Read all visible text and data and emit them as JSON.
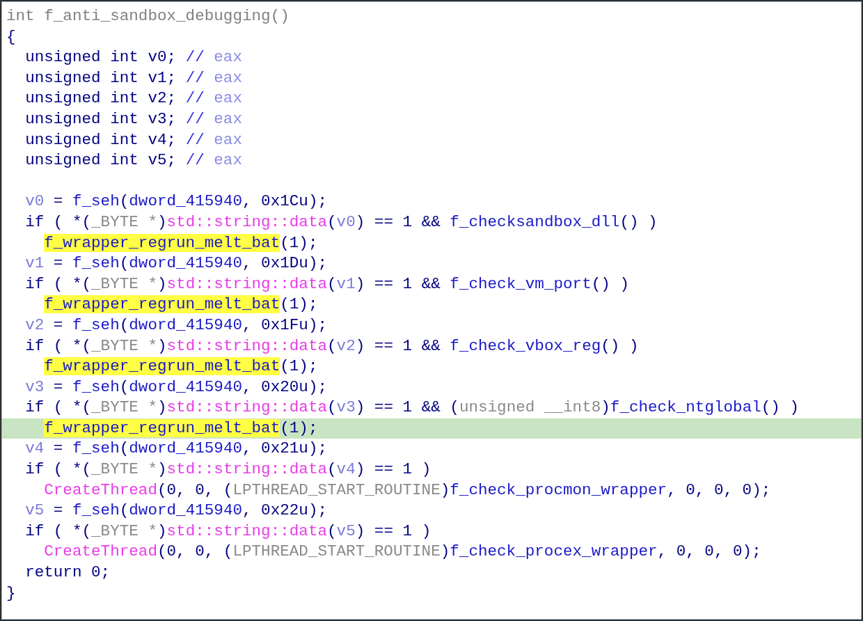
{
  "code_view": {
    "lines": [
      {
        "current": false,
        "tokens": [
          {
            "text": "int f_anti_sandbox_debugging()",
            "kind": "header"
          }
        ]
      },
      {
        "current": false,
        "tokens": [
          {
            "text": "{",
            "kind": "plain"
          }
        ]
      },
      {
        "current": false,
        "tokens": [
          {
            "text": "  unsigned int v0; ",
            "kind": "plain"
          },
          {
            "text": "// ",
            "kind": "comment"
          },
          {
            "text": "eax",
            "kind": "reg"
          }
        ]
      },
      {
        "current": false,
        "tokens": [
          {
            "text": "  unsigned int v1; ",
            "kind": "plain"
          },
          {
            "text": "// ",
            "kind": "comment"
          },
          {
            "text": "eax",
            "kind": "reg"
          }
        ]
      },
      {
        "current": false,
        "tokens": [
          {
            "text": "  unsigned int v2; ",
            "kind": "plain"
          },
          {
            "text": "// ",
            "kind": "comment"
          },
          {
            "text": "eax",
            "kind": "reg"
          }
        ]
      },
      {
        "current": false,
        "tokens": [
          {
            "text": "  unsigned int v3; ",
            "kind": "plain"
          },
          {
            "text": "// ",
            "kind": "comment"
          },
          {
            "text": "eax",
            "kind": "reg"
          }
        ]
      },
      {
        "current": false,
        "tokens": [
          {
            "text": "  unsigned int v4; ",
            "kind": "plain"
          },
          {
            "text": "// ",
            "kind": "comment"
          },
          {
            "text": "eax",
            "kind": "reg"
          }
        ]
      },
      {
        "current": false,
        "tokens": [
          {
            "text": "  unsigned int v5; ",
            "kind": "plain"
          },
          {
            "text": "// ",
            "kind": "comment"
          },
          {
            "text": "eax",
            "kind": "reg"
          }
        ]
      },
      {
        "current": false
      },
      {
        "current": false,
        "tokens": [
          {
            "text": "  v0",
            "kind": "var"
          },
          {
            "text": " = ",
            "kind": "plain"
          },
          {
            "text": "f_seh",
            "kind": "name"
          },
          {
            "text": "(",
            "kind": "plain"
          },
          {
            "text": "dword_415940",
            "kind": "name"
          },
          {
            "text": ", 0x1Cu);",
            "kind": "plain"
          }
        ]
      },
      {
        "current": false,
        "tokens": [
          {
            "text": "  if ( *(",
            "kind": "plain"
          },
          {
            "text": "_BYTE *",
            "kind": "type"
          },
          {
            "text": ")",
            "kind": "plain"
          },
          {
            "text": "std::string::data",
            "kind": "lib"
          },
          {
            "text": "(",
            "kind": "plain"
          },
          {
            "text": "v0",
            "kind": "var"
          },
          {
            "text": ") == 1 && ",
            "kind": "plain"
          },
          {
            "text": "f_checksandbox_dll",
            "kind": "name"
          },
          {
            "text": "() )",
            "kind": "plain"
          }
        ]
      },
      {
        "current": false,
        "tokens": [
          {
            "text": "    f_wrapper_regrun_melt_bat",
            "kind": "highlight"
          },
          {
            "text": "(1);",
            "kind": "plain"
          }
        ]
      },
      {
        "current": false,
        "tokens": [
          {
            "text": "  v1",
            "kind": "var"
          },
          {
            "text": " = ",
            "kind": "plain"
          },
          {
            "text": "f_seh",
            "kind": "name"
          },
          {
            "text": "(",
            "kind": "plain"
          },
          {
            "text": "dword_415940",
            "kind": "name"
          },
          {
            "text": ", 0x1Du);",
            "kind": "plain"
          }
        ]
      },
      {
        "current": false,
        "tokens": [
          {
            "text": "  if ( *(",
            "kind": "plain"
          },
          {
            "text": "_BYTE *",
            "kind": "type"
          },
          {
            "text": ")",
            "kind": "plain"
          },
          {
            "text": "std::string::data",
            "kind": "lib"
          },
          {
            "text": "(",
            "kind": "plain"
          },
          {
            "text": "v1",
            "kind": "var"
          },
          {
            "text": ") == 1 && ",
            "kind": "plain"
          },
          {
            "text": "f_check_vm_port",
            "kind": "name"
          },
          {
            "text": "() )",
            "kind": "plain"
          }
        ]
      },
      {
        "current": false,
        "tokens": [
          {
            "text": "    f_wrapper_regrun_melt_bat",
            "kind": "highlight"
          },
          {
            "text": "(1);",
            "kind": "plain"
          }
        ]
      },
      {
        "current": false,
        "tokens": [
          {
            "text": "  v2",
            "kind": "var"
          },
          {
            "text": " = ",
            "kind": "plain"
          },
          {
            "text": "f_seh",
            "kind": "name"
          },
          {
            "text": "(",
            "kind": "plain"
          },
          {
            "text": "dword_415940",
            "kind": "name"
          },
          {
            "text": ", 0x1Fu);",
            "kind": "plain"
          }
        ]
      },
      {
        "current": false,
        "tokens": [
          {
            "text": "  if ( *(",
            "kind": "plain"
          },
          {
            "text": "_BYTE *",
            "kind": "type"
          },
          {
            "text": ")",
            "kind": "plain"
          },
          {
            "text": "std::string::data",
            "kind": "lib"
          },
          {
            "text": "(",
            "kind": "plain"
          },
          {
            "text": "v2",
            "kind": "var"
          },
          {
            "text": ") == 1 && ",
            "kind": "plain"
          },
          {
            "text": "f_check_vbox_reg",
            "kind": "name"
          },
          {
            "text": "() )",
            "kind": "plain"
          }
        ]
      },
      {
        "current": false,
        "tokens": [
          {
            "text": "    f_wrapper_regrun_melt_bat",
            "kind": "highlight"
          },
          {
            "text": "(1);",
            "kind": "plain"
          }
        ]
      },
      {
        "current": false,
        "tokens": [
          {
            "text": "  v3",
            "kind": "var"
          },
          {
            "text": " = ",
            "kind": "plain"
          },
          {
            "text": "f_seh",
            "kind": "name"
          },
          {
            "text": "(",
            "kind": "plain"
          },
          {
            "text": "dword_415940",
            "kind": "name"
          },
          {
            "text": ", 0x20u);",
            "kind": "plain"
          }
        ]
      },
      {
        "current": false,
        "tokens": [
          {
            "text": "  if ( *(",
            "kind": "plain"
          },
          {
            "text": "_BYTE *",
            "kind": "type"
          },
          {
            "text": ")",
            "kind": "plain"
          },
          {
            "text": "std::string::data",
            "kind": "lib"
          },
          {
            "text": "(",
            "kind": "plain"
          },
          {
            "text": "v3",
            "kind": "var"
          },
          {
            "text": ") == 1 && (",
            "kind": "plain"
          },
          {
            "text": "unsigned __int8",
            "kind": "type"
          },
          {
            "text": ")",
            "kind": "plain"
          },
          {
            "text": "f_check_ntglobal",
            "kind": "name"
          },
          {
            "text": "() )",
            "kind": "plain"
          }
        ]
      },
      {
        "current": true,
        "tokens": [
          {
            "text": "    f_wrapper_regrun_melt_bat",
            "kind": "highlight"
          },
          {
            "text": "(1);",
            "kind": "plain"
          }
        ]
      },
      {
        "current": false,
        "tokens": [
          {
            "text": "  v4",
            "kind": "var"
          },
          {
            "text": " = ",
            "kind": "plain"
          },
          {
            "text": "f_seh",
            "kind": "name"
          },
          {
            "text": "(",
            "kind": "plain"
          },
          {
            "text": "dword_415940",
            "kind": "name"
          },
          {
            "text": ", 0x21u);",
            "kind": "plain"
          }
        ]
      },
      {
        "current": false,
        "tokens": [
          {
            "text": "  if ( *(",
            "kind": "plain"
          },
          {
            "text": "_BYTE *",
            "kind": "type"
          },
          {
            "text": ")",
            "kind": "plain"
          },
          {
            "text": "std::string::data",
            "kind": "lib"
          },
          {
            "text": "(",
            "kind": "plain"
          },
          {
            "text": "v4",
            "kind": "var"
          },
          {
            "text": ") == 1 )",
            "kind": "plain"
          }
        ]
      },
      {
        "current": false,
        "tokens": [
          {
            "text": "    CreateThread",
            "kind": "lib"
          },
          {
            "text": "(0, 0, (",
            "kind": "plain"
          },
          {
            "text": "LPTHREAD_START_ROUTINE",
            "kind": "type"
          },
          {
            "text": ")",
            "kind": "plain"
          },
          {
            "text": "f_check_procmon_wrapper",
            "kind": "name"
          },
          {
            "text": ", 0, 0, 0);",
            "kind": "plain"
          }
        ]
      },
      {
        "current": false,
        "tokens": [
          {
            "text": "  v5",
            "kind": "var"
          },
          {
            "text": " = ",
            "kind": "plain"
          },
          {
            "text": "f_seh",
            "kind": "name"
          },
          {
            "text": "(",
            "kind": "plain"
          },
          {
            "text": "dword_415940",
            "kind": "name"
          },
          {
            "text": ", 0x22u);",
            "kind": "plain"
          }
        ]
      },
      {
        "current": false,
        "tokens": [
          {
            "text": "  if ( *(",
            "kind": "plain"
          },
          {
            "text": "_BYTE *",
            "kind": "type"
          },
          {
            "text": ")",
            "kind": "plain"
          },
          {
            "text": "std::string::data",
            "kind": "lib"
          },
          {
            "text": "(",
            "kind": "plain"
          },
          {
            "text": "v5",
            "kind": "var"
          },
          {
            "text": ") == 1 )",
            "kind": "plain"
          }
        ]
      },
      {
        "current": false,
        "tokens": [
          {
            "text": "    CreateThread",
            "kind": "lib"
          },
          {
            "text": "(0, 0, (",
            "kind": "plain"
          },
          {
            "text": "LPTHREAD_START_ROUTINE",
            "kind": "type"
          },
          {
            "text": ")",
            "kind": "plain"
          },
          {
            "text": "f_check_procex_wrapper",
            "kind": "name"
          },
          {
            "text": ", 0, 0, 0);",
            "kind": "plain"
          }
        ]
      },
      {
        "current": false,
        "tokens": [
          {
            "text": "  return 0;",
            "kind": "plain"
          }
        ]
      },
      {
        "current": false,
        "tokens": [
          {
            "text": "}",
            "kind": "plain"
          }
        ]
      }
    ]
  }
}
